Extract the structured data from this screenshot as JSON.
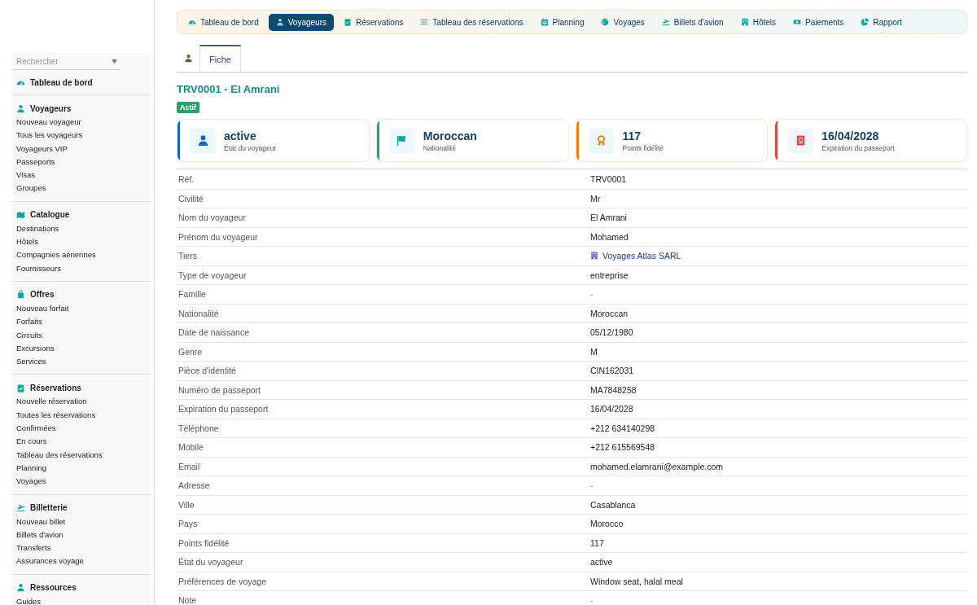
{
  "sidebar": {
    "search": {
      "placeholder": "Rechercher"
    },
    "sections": [
      {
        "title": "Tableau de bord"
      },
      {
        "title": "Voyageurs",
        "items": [
          "Nouveau voyageur",
          "Tous les voyageurs",
          "Voyageurs VIP",
          "Passeports",
          "Visas",
          "Groupes"
        ]
      },
      {
        "title": "Catalogue",
        "items": [
          "Destinations",
          "Hôtels",
          "Compagnies aériennes",
          "Fournisseurs"
        ]
      },
      {
        "title": "Offres",
        "items": [
          "Nouveau forfait",
          "Forfaits",
          "Circuits",
          "Excursions",
          "Services"
        ]
      },
      {
        "title": "Réservations",
        "items": [
          "Nouvelle réservation",
          "Toutes les réservations",
          "Confirmées",
          "En cours",
          "Tableau des réservations",
          "Planning",
          "Voyages"
        ]
      },
      {
        "title": "Billetterie",
        "items": [
          "Nouveau billet",
          "Billets d'avion",
          "Transferts",
          "Assurances voyage"
        ]
      },
      {
        "title": "Ressources",
        "items": [
          "Guides"
        ]
      }
    ]
  },
  "top_nav": [
    {
      "label": "Tableau de bord",
      "selected": false
    },
    {
      "label": "Voyageurs",
      "selected": true
    },
    {
      "label": "Réservations",
      "selected": false
    },
    {
      "label": "Tableau des réservations",
      "selected": false
    },
    {
      "label": "Planning",
      "selected": false
    },
    {
      "label": "Voyages",
      "selected": false
    },
    {
      "label": "Billets d'avion",
      "selected": false
    },
    {
      "label": "Hôtels",
      "selected": false
    },
    {
      "label": "Paiements",
      "selected": false
    },
    {
      "label": "Rapport",
      "selected": false
    }
  ],
  "tabs": [
    {
      "label": "Fiche",
      "selected": true
    }
  ],
  "record": {
    "title": "TRV0001 - El Amrani",
    "status_badge": "Actif"
  },
  "stat_cards": [
    {
      "value": "active",
      "label": "État du voyageur",
      "color": "#1565c0"
    },
    {
      "value": "Moroccan",
      "label": "Nationalité",
      "color": "#17a2a2"
    },
    {
      "value": "117",
      "label": "Points fidélité",
      "color": "#f57c00"
    },
    {
      "value": "16/04/2028",
      "label": "Expiration du passeport",
      "color": "#e04848"
    }
  ],
  "fields": [
    {
      "label": "Réf.",
      "value": "TRV0001"
    },
    {
      "label": "Civilité",
      "value": "Mr"
    },
    {
      "label": "Nom du voyageur",
      "value": "El Amrani"
    },
    {
      "label": "Prénom du voyageur",
      "value": "Mohamed"
    },
    {
      "label": "Tiers",
      "value": "Voyages Atlas SARL",
      "kind": "link"
    },
    {
      "label": "Type de voyageur",
      "value": "entreprise"
    },
    {
      "label": "Famille",
      "value": "-",
      "kind": "empty"
    },
    {
      "label": "Nationalité",
      "value": "Moroccan"
    },
    {
      "label": "Date de naissance",
      "value": "05/12/1980"
    },
    {
      "label": "Genre",
      "value": "M"
    },
    {
      "label": "Pièce d'identité",
      "value": "CIN162031"
    },
    {
      "label": "Numéro de passeport",
      "value": "MA7848258"
    },
    {
      "label": "Expiration du passeport",
      "value": "16/04/2028"
    },
    {
      "label": "Téléphone",
      "value": "+212 634140298"
    },
    {
      "label": "Mobile",
      "value": "+212 615569548"
    },
    {
      "label": "Email",
      "value": "mohamed.elamrani@example.com"
    },
    {
      "label": "Adresse",
      "value": "-",
      "kind": "empty"
    },
    {
      "label": "Ville",
      "value": "Casablanca"
    },
    {
      "label": "Pays",
      "value": "Morocco"
    },
    {
      "label": "Points fidélité",
      "value": "117"
    },
    {
      "label": "État du voyageur",
      "value": "active"
    },
    {
      "label": "Préférences de voyage",
      "value": "Window seat, halal meal"
    },
    {
      "label": "Note",
      "value": "-",
      "kind": "empty"
    }
  ]
}
